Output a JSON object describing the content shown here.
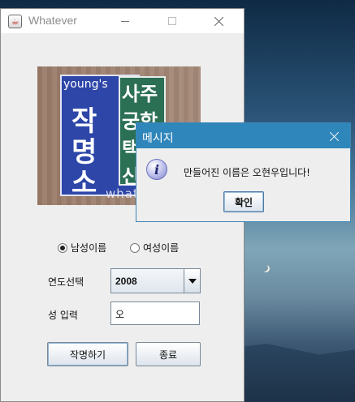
{
  "main_window": {
    "title": "Whatever",
    "photo_text": {
      "brand": "young's",
      "big": [
        "작",
        "명",
        "소"
      ],
      "green": [
        "사주",
        "궁합",
        "택",
        "신"
      ],
      "watermark": "whatever"
    },
    "gender": {
      "options": [
        {
          "label": "남성이름",
          "selected": true
        },
        {
          "label": "여성이름",
          "selected": false
        }
      ]
    },
    "year": {
      "label": "연도선택",
      "value": "2008"
    },
    "surname": {
      "label": "성 입력",
      "value": "오"
    },
    "buttons": {
      "create": "작명하기",
      "exit": "종료"
    }
  },
  "dialog": {
    "title": "메시지",
    "message": "만들어진 이름은 오현우입니다!",
    "ok": "확인"
  },
  "colors": {
    "dialog_titlebar": "#2f86bb",
    "window_bg": "#eeeeee"
  }
}
